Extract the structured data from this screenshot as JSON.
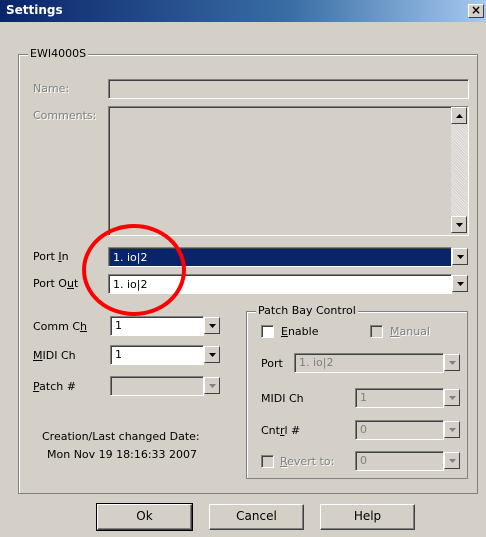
{
  "window": {
    "title": "Settings",
    "close_label": "×"
  },
  "device_group": {
    "legend": "EWI4000S"
  },
  "name_label": "Name:",
  "comments_label": "Comments:",
  "port_in": {
    "label": "Port In",
    "value": "1. io|2"
  },
  "port_out": {
    "label": "Port Out",
    "value": "1. io|2"
  },
  "comm_ch": {
    "label": "Comm Ch",
    "value": "1"
  },
  "midi_ch": {
    "label": "MIDI Ch",
    "value": "1"
  },
  "patch_num": {
    "label": "Patch #",
    "value": ""
  },
  "date_info": {
    "label": "Creation/Last changed Date:",
    "value": "Mon Nov 19 18:16:33 2007"
  },
  "patch_bay": {
    "legend": "Patch Bay Control",
    "enable_label": "Enable",
    "manual_label": "Manual",
    "port_label": "Port",
    "port_value": "1. io|2",
    "midi_ch_label": "MIDI Ch",
    "midi_ch_value": "1",
    "cntrl_label": "Cntrl #",
    "cntrl_value": "0",
    "revert_label": "Revert to:",
    "revert_value": "0"
  },
  "buttons": {
    "ok": "Ok",
    "cancel": "Cancel",
    "help": "Help"
  },
  "annotation": {
    "color": "#ff0000",
    "shape": "circle"
  }
}
